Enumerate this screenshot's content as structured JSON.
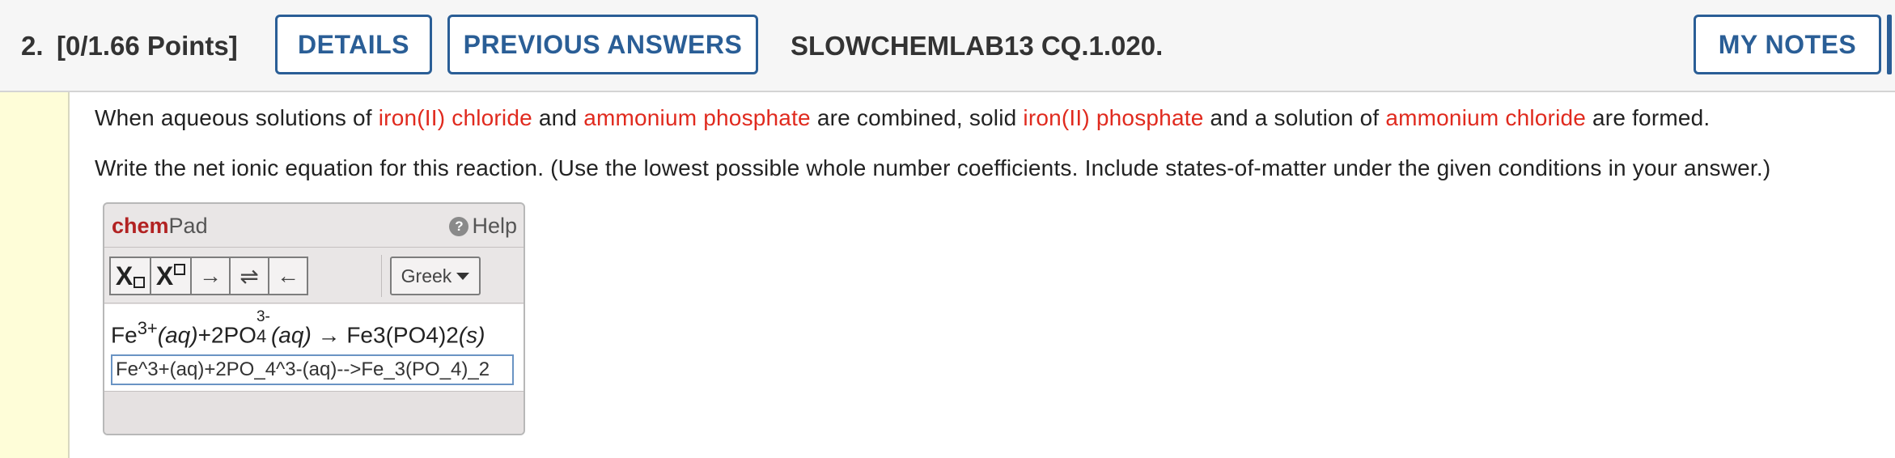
{
  "header": {
    "question_number": "2.",
    "points": "[0/1.66 Points]",
    "details_label": "DETAILS",
    "previous_answers_label": "PREVIOUS ANSWERS",
    "question_code": "SLOWCHEMLAB13 CQ.1.020.",
    "my_notes_label": "MY NOTES"
  },
  "question": {
    "p1": {
      "t1": "When aqueous solutions of ",
      "r1": "iron(II) chloride",
      "t2": " and ",
      "r2": "ammonium phosphate",
      "t3": " are combined, solid ",
      "r3": "iron(II) phosphate",
      "t4": " and a solution of ",
      "r4": "ammonium chloride",
      "t5": " are formed."
    },
    "p2": "Write the net ionic equation for this reaction. (Use the lowest possible whole number coefficients. Include states-of-matter under the given conditions in your answer.)"
  },
  "chempad": {
    "brand_bold": "chem",
    "brand_rest": "Pad",
    "help_label": "Help",
    "tools": {
      "subscript": "X",
      "superscript": "X",
      "arrow_right": "→",
      "equilibrium": "⇌",
      "arrow_left": "←"
    },
    "greek_label": "Greek",
    "rendered": {
      "fe": "Fe",
      "fe_charge": "3+",
      "aq1": "(aq)",
      "plus": "+2PO",
      "po4_charge": "3-",
      "po4_sub": "4",
      "aq2": "(aq)",
      "arrow": " → ",
      "product_a": "Fe",
      "product_b": "3",
      "product_c": "(PO",
      "product_d": "4",
      "product_e": ")",
      "product_f": "2",
      "product_g": "(s)"
    },
    "input_value": "Fe^3+(aq)+2PO_4^3-(aq)-->Fe_3(PO_4)_2"
  },
  "colors": {
    "accent": "#2a5e96",
    "highlight_red": "#e02a1e",
    "gutter": "#fefdd8"
  }
}
